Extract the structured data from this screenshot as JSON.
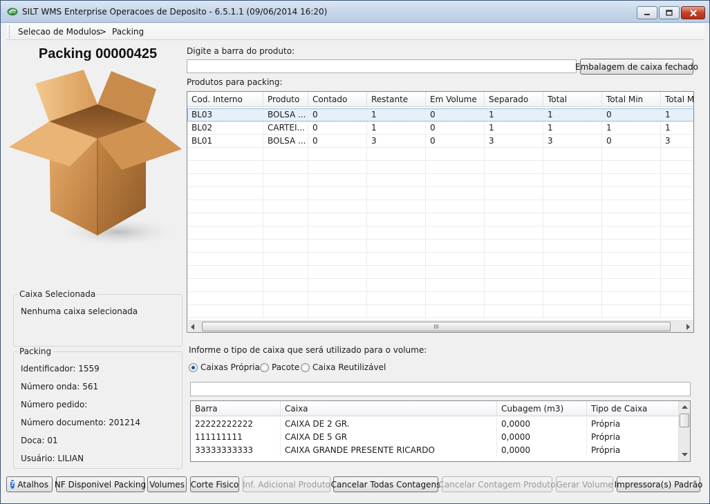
{
  "window": {
    "title": "SILT WMS Enterprise Operacoes de Deposito - 6.5.1.1 (09/06/2014 16:20)"
  },
  "breadcrumb": {
    "items": [
      "Selecao de Modulos",
      ">",
      "Packing"
    ]
  },
  "left": {
    "packing_title": "Packing 00000425",
    "caixa_group": {
      "label": "Caixa Selecionada",
      "value": "Nenhuma caixa selecionada"
    },
    "packing_group": {
      "label": "Packing",
      "lines": [
        "Identificador: 1559",
        "Número onda: 561",
        "Número pedido:",
        "Número documento: 201214",
        "Doca: 01",
        "Usuário: LILIAN"
      ]
    }
  },
  "barcode": {
    "label": "Digite a barra do produto:",
    "value": "",
    "button": "Embalagem de caixa fechado"
  },
  "products": {
    "label": "Produtos para packing:",
    "columns": [
      "Cod. Interno",
      "Produto",
      "Contado",
      "Restante",
      "Em Volume",
      "Separado",
      "Total",
      "Total Min",
      "Total M"
    ],
    "rows": [
      [
        "BL03",
        "BOLSA ...",
        "0",
        "1",
        "0",
        "1",
        "1",
        "0",
        "1"
      ],
      [
        "BL02",
        "CARTEI...",
        "0",
        "1",
        "0",
        "1",
        "1",
        "1",
        "1"
      ],
      [
        "BL01",
        "BOLSA ...",
        "0",
        "3",
        "0",
        "3",
        "3",
        "0",
        "3"
      ]
    ],
    "scroll_thumb": "III"
  },
  "box_type": {
    "label": "Informe o tipo de caixa que será utilizado para o volume:",
    "options": [
      "Caixas Próprias",
      "Pacote",
      "Caixa Reutilizável"
    ],
    "selected": "Caixas Próprias",
    "filter_value": ""
  },
  "boxes": {
    "columns": [
      "Barra",
      "Caixa",
      "Cubagem (m3)",
      "Tipo de Caixa"
    ],
    "rows": [
      [
        "22222222222",
        "CAIXA DE 2 GR.",
        "0,0000",
        "Própria"
      ],
      [
        "111111111",
        "CAIXA DE 5 GR",
        "0,0000",
        "Própria"
      ],
      [
        "33333333333",
        "CAIXA GRANDE PRESENTE RICARDO",
        "0,0000",
        "Própria"
      ]
    ]
  },
  "toolbar": {
    "buttons": [
      {
        "label": "Atalhos",
        "enabled": true
      },
      {
        "label": "NF Disponivel Packing",
        "enabled": true
      },
      {
        "label": "Volumes",
        "enabled": true
      },
      {
        "label": "Corte Fisico",
        "enabled": true
      },
      {
        "label": "Inf. Adicional Produto",
        "enabled": false
      },
      {
        "label": "Cancelar Todas Contagens",
        "enabled": true
      },
      {
        "label": "Cancelar Contagem Produto",
        "enabled": false
      },
      {
        "label": "Gerar Volume",
        "enabled": false
      },
      {
        "label": "Impressora(s) Padrão",
        "enabled": true
      }
    ]
  },
  "colors": {
    "title_bar": "#c5d6ea",
    "selected_row": "#e6f0fb",
    "close_button": "#c5402a"
  }
}
